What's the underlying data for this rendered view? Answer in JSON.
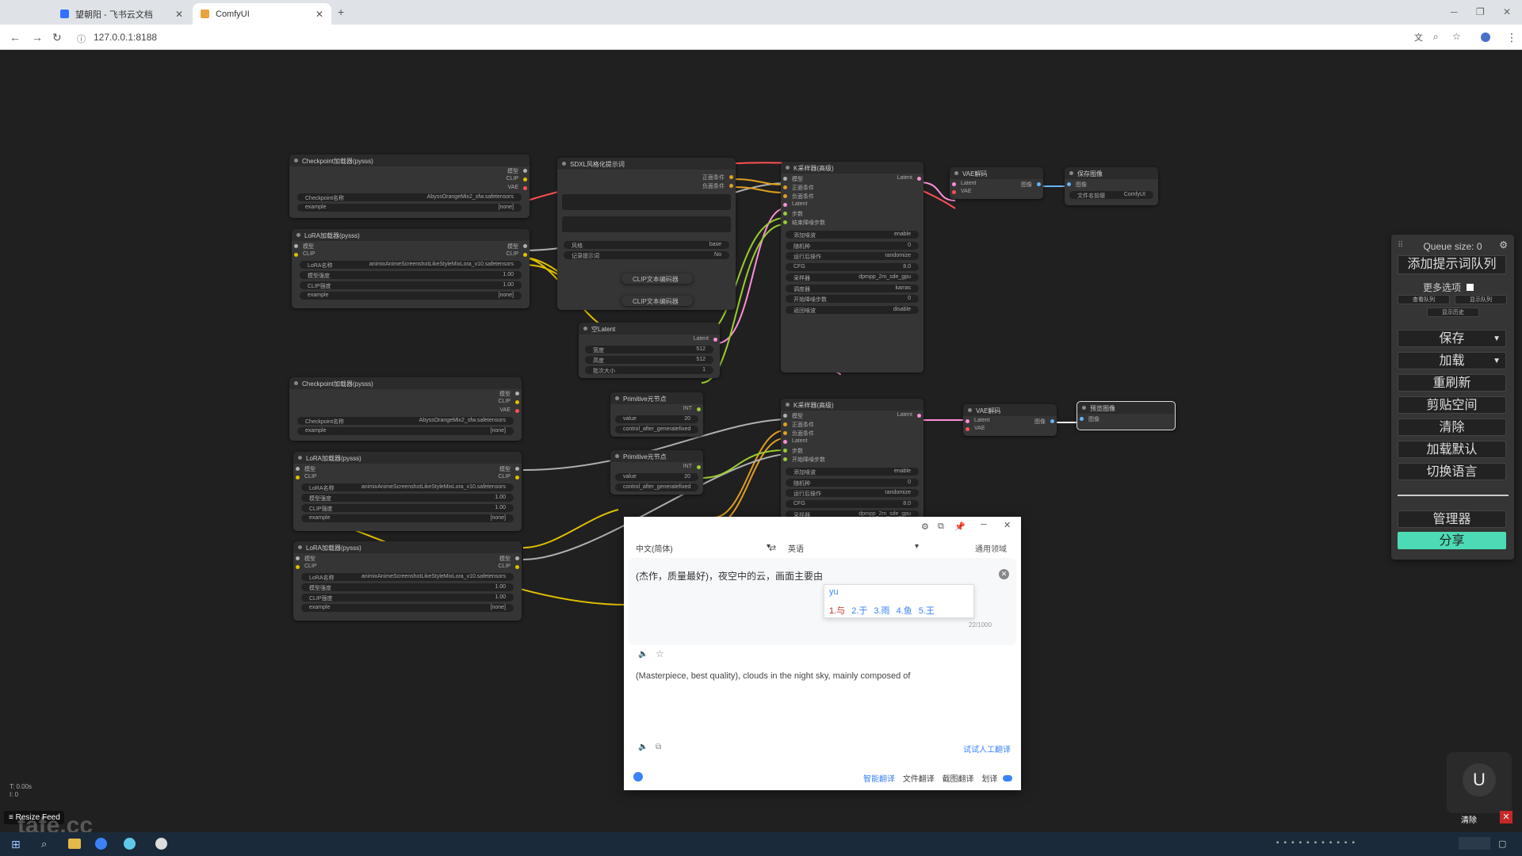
{
  "browser": {
    "tabs": [
      {
        "label": "望朝阳 - 飞书云文档",
        "active": false
      },
      {
        "label": "ComfyUI",
        "active": true
      }
    ],
    "url": "127.0.0.1:8188"
  },
  "nodes": {
    "checkpoint1": {
      "title": "Checkpoint加载器(pysss)",
      "outputs": [
        "模型",
        "CLIP",
        "VAE"
      ],
      "ckpt_label": "Checkpoint名称",
      "ckpt_value": "AbyssOrangeMix2_sfw.safetensors",
      "example_label": "example",
      "example_value": "[none]"
    },
    "lora1": {
      "title": "LoRA加载器(pysss)",
      "inputs": [
        "模型",
        "CLIP"
      ],
      "outputs": [
        "模型",
        "CLIP"
      ],
      "lora_label": "LoRA名称",
      "lora_value": "animixAnimeScreenshotLikeStyleMixLora_v10.safetensors",
      "model_strength_label": "模型强度",
      "model_strength": "1.00",
      "clip_strength_label": "CLIP强度",
      "clip_strength": "1.00",
      "example_label": "example",
      "example_value": "[none]"
    },
    "sdxl": {
      "title": "SDXL风格化提示词",
      "outputs": [
        "正面条件",
        "负面条件"
      ],
      "style_label": "风格",
      "style_value": "base",
      "log_label": "记录提示词",
      "log_value": "No"
    },
    "clip_enc1": {
      "title": "CLIP文本编码器"
    },
    "clip_enc2": {
      "title": "CLIP文本编码器"
    },
    "latent": {
      "title": "空Latent",
      "output": "Latent",
      "width_label": "宽度",
      "width": "512",
      "height_label": "高度",
      "height": "512",
      "batch_label": "批次大小",
      "batch": "1"
    },
    "primitive1": {
      "title": "Primitive元节点",
      "output": "INT",
      "value_label": "value",
      "value": "20",
      "control_label": "control_after_generate",
      "control_value": "fixed"
    },
    "primitive2": {
      "title": "Primitive元节点",
      "output": "INT",
      "value_label": "value",
      "value": "20",
      "control_label": "control_after_generate",
      "control_value": "fixed"
    },
    "ksampler1": {
      "title": "K采样器(高级)",
      "inputs": [
        "模型",
        "正面条件",
        "负面条件",
        "Latent",
        "步数",
        "结束降噪步数"
      ],
      "output": "Latent",
      "widgets": [
        [
          "添加噪波",
          "enable"
        ],
        [
          "随机种",
          "0"
        ],
        [
          "运行后操作",
          "randomize"
        ],
        [
          "CFG",
          "8.0"
        ],
        [
          "采样器",
          "dpmpp_2m_sde_gpu"
        ],
        [
          "调度器",
          "karras"
        ],
        [
          "开始降噪步数",
          "0"
        ],
        [
          "返回噪波",
          "disable"
        ]
      ]
    },
    "ksampler2": {
      "title": "K采样器(高级)",
      "inputs": [
        "模型",
        "正面条件",
        "负面条件",
        "Latent",
        "步数",
        "开始降噪步数"
      ],
      "output": "Latent",
      "widgets": [
        [
          "添加噪波",
          "enable"
        ],
        [
          "随机种",
          "0"
        ],
        [
          "运行后操作",
          "randomize"
        ],
        [
          "CFG",
          "8.0"
        ],
        [
          "采样器",
          "dpmpp_2m_sde_gpu"
        ]
      ]
    },
    "vae1": {
      "title": "VAE解码",
      "inputs": [
        "Latent",
        "VAE"
      ],
      "output": "图像"
    },
    "save": {
      "title": "保存图像",
      "input": "图像",
      "prefix_label": "文件名前缀",
      "prefix_value": "ComfyUI"
    },
    "checkpoint2": {
      "title": "Checkpoint加载器(pysss)",
      "outputs": [
        "模型",
        "CLIP",
        "VAE"
      ],
      "ckpt_label": "Checkpoint名称",
      "ckpt_value": "AbyssOrangeMix2_sfw.safetensors",
      "example_label": "example",
      "example_value": "[none]"
    },
    "lora2": {
      "title": "LoRA加载器(pysss)",
      "inputs": [
        "模型",
        "CLIP"
      ],
      "outputs": [
        "模型",
        "CLIP"
      ],
      "lora_label": "LoRA名称",
      "lora_value": "animixAnimeScreenshotLikeStyleMixLora_v10.safetensors",
      "model_strength_label": "模型强度",
      "model_strength": "1.00",
      "clip_strength_label": "CLIP强度",
      "clip_strength": "1.00",
      "example_label": "example",
      "example_value": "[none]"
    },
    "lora3": {
      "title": "LoRA加载器(pysss)",
      "inputs": [
        "模型",
        "CLIP"
      ],
      "outputs": [
        "模型",
        "CLIP"
      ],
      "lora_label": "LoRA名称",
      "lora_value": "animixAnimeScreenshotLikeStyleMixLora_v10.safetensors",
      "model_strength_label": "模型强度",
      "model_strength": "1.00",
      "clip_strength_label": "CLIP强度",
      "clip_strength": "1.00",
      "example_label": "example",
      "example_value": "[none]"
    },
    "vae2": {
      "title": "VAE解码",
      "inputs": [
        "Latent",
        "VAE"
      ],
      "output": "图像"
    },
    "preview": {
      "title": "预览图像",
      "input": "图像"
    }
  },
  "queue": {
    "title": "Queue size: 0",
    "queue_prompt": "添加提示词队列",
    "extra_options": "更多选项",
    "view_queue": "查看队列",
    "view_queue2": "显示队列",
    "view_history": "显示历史",
    "save": "保存",
    "load": "加载",
    "refresh": "重刷新",
    "clipspace": "剪贴空间",
    "clear": "清除",
    "load_default": "加载默认",
    "switch_lang": "切换语言",
    "manager": "管理器",
    "share": "分享"
  },
  "translator": {
    "source_lang": "中文(简体)",
    "target_lang": "英语",
    "domain": "通用领域",
    "source_text": "(杰作，质量最好)，夜空中的云，画面主要由",
    "ime_input": "yu",
    "ime_candidates": [
      "1.与",
      "2.于",
      "3.雨",
      "4.鱼",
      "5.王"
    ],
    "char_count": "22/1000",
    "output_text": "(Masterpiece, best quality), clouds in the night sky, mainly composed of",
    "human_translate": "试试人工翻译",
    "footer": [
      "智能翻译",
      "文件翻译",
      "截图翻译",
      "划译"
    ]
  },
  "overlay": {
    "stats1": "T: 0.00s",
    "stats2": "I: 0",
    "resize_feed": "Resize Feed",
    "clear": "清除",
    "avatar": "U",
    "watermark": "tafe.cc"
  }
}
